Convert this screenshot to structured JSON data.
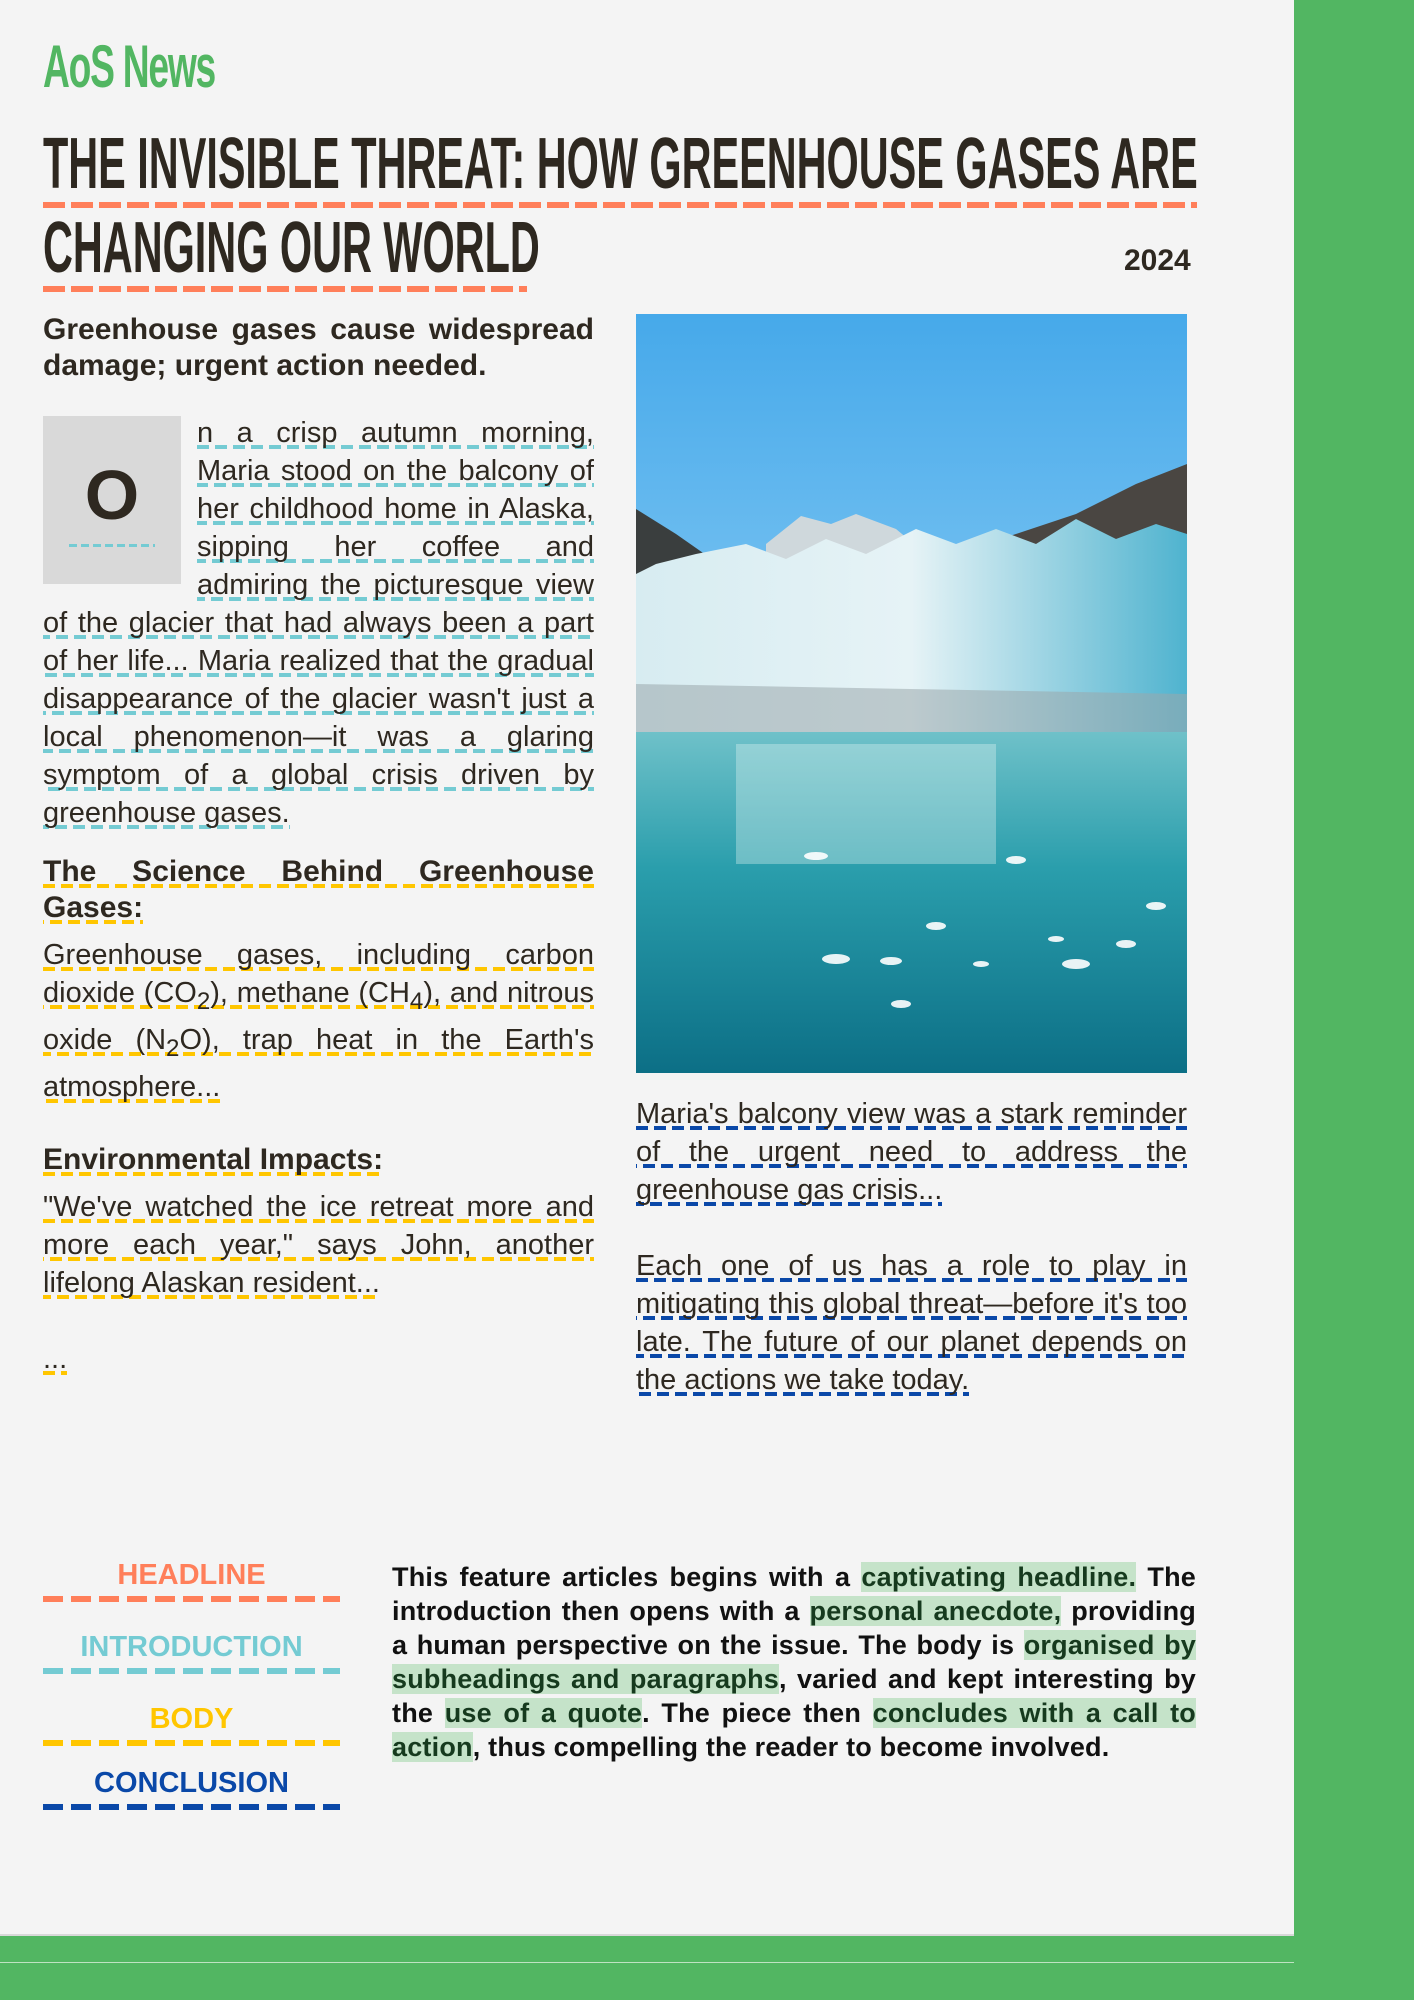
{
  "brand": "AoS News",
  "headline": {
    "line1": "THE INVISIBLE THREAT: HOW GREENHOUSE GASES ARE",
    "line2": "CHANGING OUR WORLD"
  },
  "year": "2024",
  "standfirst": "Greenhouse gases cause widespread damage; urgent action needed.",
  "intro": {
    "dropcap": "O",
    "text": "n a crisp autumn morning, Maria stood on the balcony of her childhood home in Alaska, sipping her coffee and admiring the picturesque view of the glacier that had always been a part of her life... Maria realized that the gradual disappearance of the glacier wasn't just a local phenomenon—it was a glaring symptom of a global crisis driven by greenhouse gases."
  },
  "body": {
    "sub1": "The Science Behind Greenhouse Gases:",
    "p1_a": "Greenhouse gases, including carbon dioxide (CO",
    "p1_sub1": "2",
    "p1_b": "), methane (CH",
    "p1_sub2": "4",
    "p1_c": "), and nitrous oxide (N",
    "p1_sub3": "2",
    "p1_d": "O), trap heat in the Earth's atmosphere...",
    "sub2": "Environmental Impacts:",
    "p2": "\"We've watched the ice retreat more and more each year,\" says John, another lifelong Alaskan resident...",
    "ellipsis": "..."
  },
  "image": {
    "alt": "Glacier meeting turquoise water with floating ice, mountains behind under blue sky"
  },
  "conclusion": {
    "p1": "Maria's balcony view was a stark reminder of the urgent need to address the greenhouse gas crisis...",
    "p2": "Each one of us has a role to play in mitigating this global threat—before it's too late. The future of our planet depends on the actions we take today."
  },
  "legend": [
    {
      "label": "HEADLINE",
      "color": "#ff7f5a"
    },
    {
      "label": "INTRODUCTION",
      "color": "#74cbd3"
    },
    {
      "label": "BODY",
      "color": "#ffc600"
    },
    {
      "label": "CONCLUSION",
      "color": "#0a48a8"
    }
  ],
  "summary": {
    "t1": "This feature articles begins with a ",
    "h1": "captivating headline.",
    "t2": " The introduction then opens with a ",
    "h2": "personal anecdote,",
    "t3": " providing a human perspective on the issue. The body is ",
    "h3": "organised by subheadings and paragraphs",
    "t4": ", varied and kept interesting by the ",
    "h4": "use of a quote",
    "t5": ". The piece then ",
    "h5": "concludes with a call to action",
    "t6": ", thus compelling the reader to become involved."
  },
  "colors": {
    "brand_green": "#52b662",
    "headline": "#ff7f5a",
    "introduction": "#74cbd3",
    "body": "#ffc600",
    "conclusion": "#0a48a8",
    "highlight": "#c5e3c9"
  }
}
